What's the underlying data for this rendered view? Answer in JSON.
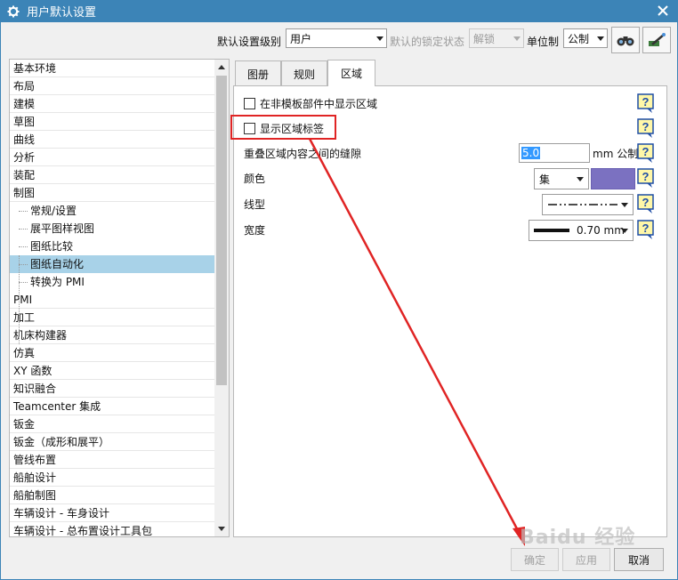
{
  "window": {
    "title": "用户默认设置"
  },
  "toolbar": {
    "level_label": "默认设置级别",
    "level_value": "用户",
    "lock_label": "默认的锁定状态",
    "lock_value": "解锁",
    "unit_label": "单位制",
    "unit_value": "公制"
  },
  "tree": {
    "items": [
      "基本环境",
      "布局",
      "建模",
      "草图",
      "曲线",
      "分析",
      "装配",
      "制图",
      "常规/设置",
      "展平图样视图",
      "图纸比较",
      "图纸自动化",
      "转换为 PMI",
      "PMI",
      "加工",
      "机床构建器",
      "仿真",
      "XY 函数",
      "知识融合",
      "Teamcenter 集成",
      "钣金",
      "钣金（成形和展平）",
      "管线布置",
      "船舶设计",
      "船舶制图",
      "车辆设计 - 车身设计",
      "车辆设计 - 总布置设计工具包"
    ],
    "selected": "图纸自动化"
  },
  "tabs": [
    "图册",
    "规则",
    "区域"
  ],
  "active_tab": "区域",
  "region": {
    "show_region_label": "在非模板部件中显示区域",
    "show_region_tag_label": "显示区域标签",
    "gap_label": "重叠区域内容之间的缝隙",
    "gap_value": "5.0",
    "gap_unit": "mm 公制",
    "color_label": "颜色",
    "color_mode": "集",
    "color_value": "#7b71c1",
    "linetype_label": "线型",
    "width_label": "宽度",
    "width_value": "0.70 mm"
  },
  "buttons": {
    "ok": "确定",
    "apply": "应用",
    "cancel": "取消"
  },
  "watermark": "Baidu 经验",
  "help_icon_text": "?"
}
